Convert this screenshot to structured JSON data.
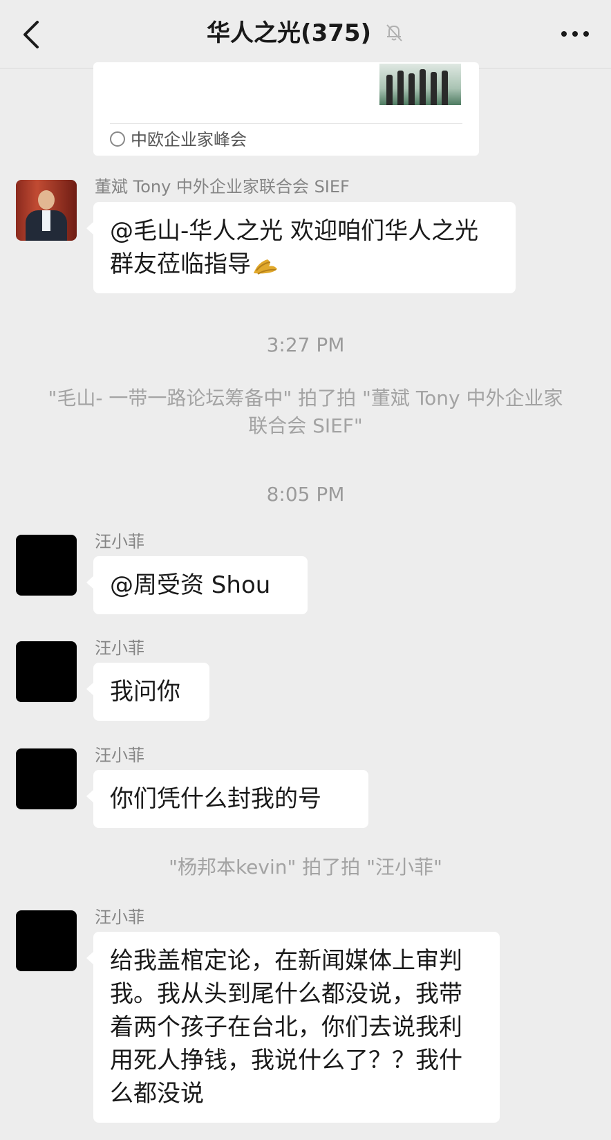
{
  "header": {
    "title": "华人之光(375)"
  },
  "card": {
    "source": "中欧企业家峰会"
  },
  "messages": [
    {
      "sender": "董斌 Tony 中外企业家联合会 SIEF",
      "text": "@毛山-华人之光 欢迎咱们华人之光群友莅临指导"
    },
    {
      "sender": "汪小菲",
      "text": "@周受资 Shou"
    },
    {
      "sender": "汪小菲",
      "text": "我问你"
    },
    {
      "sender": "汪小菲",
      "text": "你们凭什么封我的号"
    },
    {
      "sender": "汪小菲",
      "text": "给我盖棺定论，在新闻媒体上审判我。我从头到尾什么都没说，我带着两个孩子在台北，你们去说我利用死人挣钱，我说什么了？？我什么都没说"
    }
  ],
  "timestamps": [
    "3:27 PM",
    "8:05 PM"
  ],
  "system_notices": [
    "\"毛山- 一带一路论坛筹备中\" 拍了拍 \"董斌 Tony 中外企业家联合会 SIEF\"",
    "\"杨邦本kevin\" 拍了拍 \"汪小菲\""
  ],
  "icons": {
    "back": "chevron-left-icon",
    "mute": "bell-muted-icon",
    "more": "more-dots-icon",
    "emoji": "clap-emoji"
  },
  "colors": {
    "background": "#ededed",
    "bubble": "#ffffff",
    "meta_text": "#9b9b9b"
  }
}
